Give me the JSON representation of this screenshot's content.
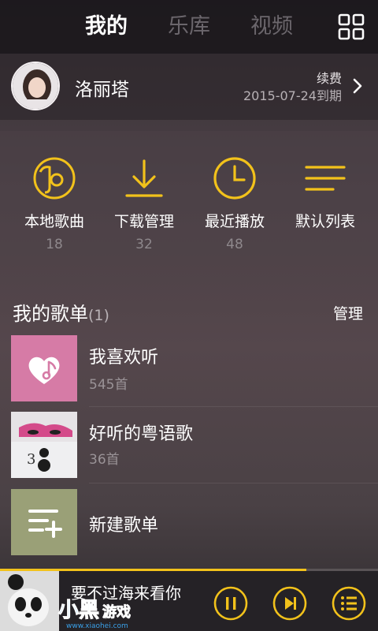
{
  "tabs": [
    {
      "label": "我的",
      "active": true
    },
    {
      "label": "乐库",
      "active": false
    },
    {
      "label": "视频",
      "active": false
    }
  ],
  "profile": {
    "username": "洛丽塔",
    "renew_label": "续费",
    "expire_text": "2015-07-24到期"
  },
  "quick": [
    {
      "label": "本地歌曲",
      "count": "18",
      "icon": "local-music-icon"
    },
    {
      "label": "下载管理",
      "count": "32",
      "icon": "download-icon"
    },
    {
      "label": "最近播放",
      "count": "48",
      "icon": "clock-icon"
    },
    {
      "label": "默认列表",
      "count": "",
      "icon": "list-icon"
    }
  ],
  "playlists": {
    "title": "我的歌单",
    "count": "(1)",
    "manage_label": "管理",
    "items": [
      {
        "name": "我喜欢听",
        "count": "545首"
      },
      {
        "name": "好听的粤语歌",
        "count": "36首"
      },
      {
        "name": "新建歌单",
        "count": ""
      }
    ]
  },
  "player": {
    "now_playing": "要不过海来看你",
    "progress": 0.81
  },
  "watermark": {
    "text": "小黑游戏",
    "url": "www.xiaohei.com"
  },
  "colors": {
    "accent": "#f2c21b",
    "heart_bg": "#d67ba6",
    "new_bg": "#9aa077"
  }
}
